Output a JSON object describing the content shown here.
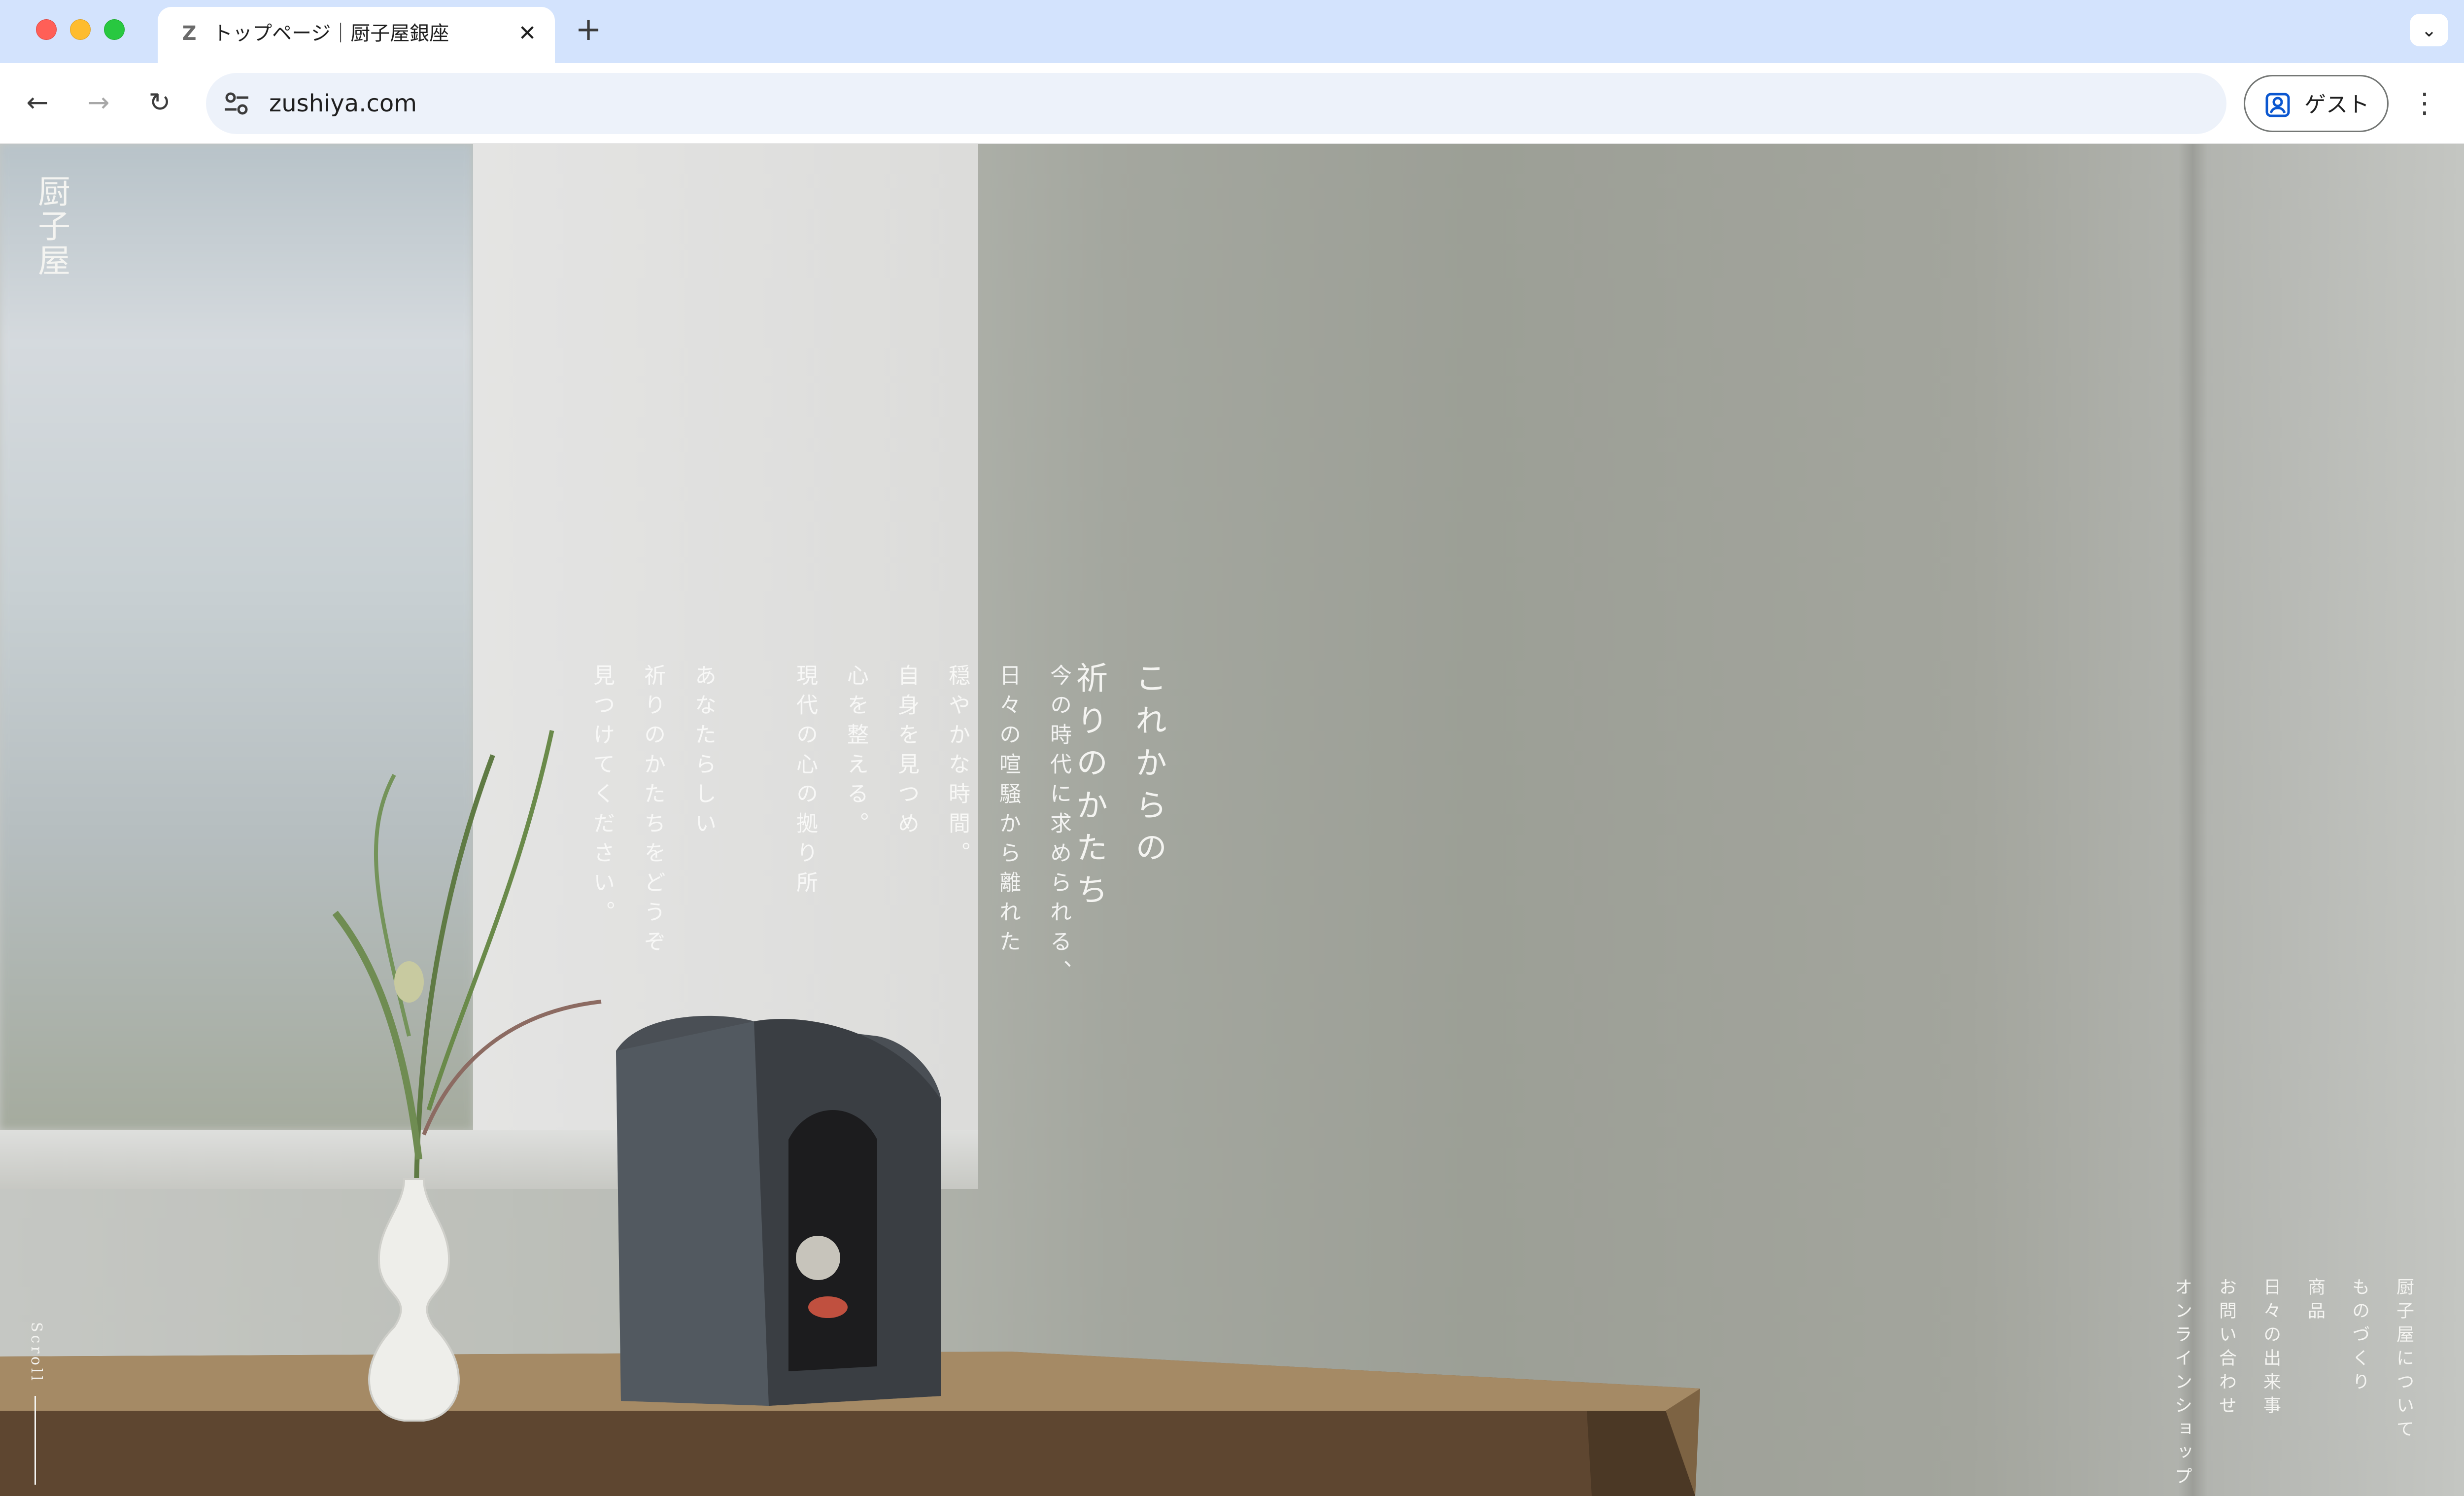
{
  "browser": {
    "tab": {
      "title": "トップページ｜厨子屋銀座",
      "favicon_letter": "Z"
    },
    "url": "zushiya.com",
    "guest_label": "ゲスト",
    "icons": {
      "close": "close-icon",
      "new_tab": "plus-icon",
      "back": "back-arrow-icon",
      "forward": "forward-arrow-icon",
      "reload": "reload-icon",
      "site_info": "tune-icon",
      "profile": "person-icon",
      "menu": "more-vert-icon",
      "tab_list": "chevron-down-icon"
    }
  },
  "page": {
    "logo": "厨子屋",
    "headline": [
      "これからの",
      "祈りのかたち"
    ],
    "body": [
      "今の時代に求められる、",
      "日々の喧騒から離れた",
      "穏やかな時間。",
      "自身を見つめ",
      "心を整える。",
      "現代の心の拠り所",
      "あなたらしい",
      "祈りのかたちをどうぞ",
      "見つけてください。"
    ],
    "scroll_label": "Scroll",
    "nav": [
      "厨子屋について",
      "ものづくり",
      "商品",
      "日々の出来事",
      "お問い合わせ",
      "オンラインショップ"
    ]
  }
}
